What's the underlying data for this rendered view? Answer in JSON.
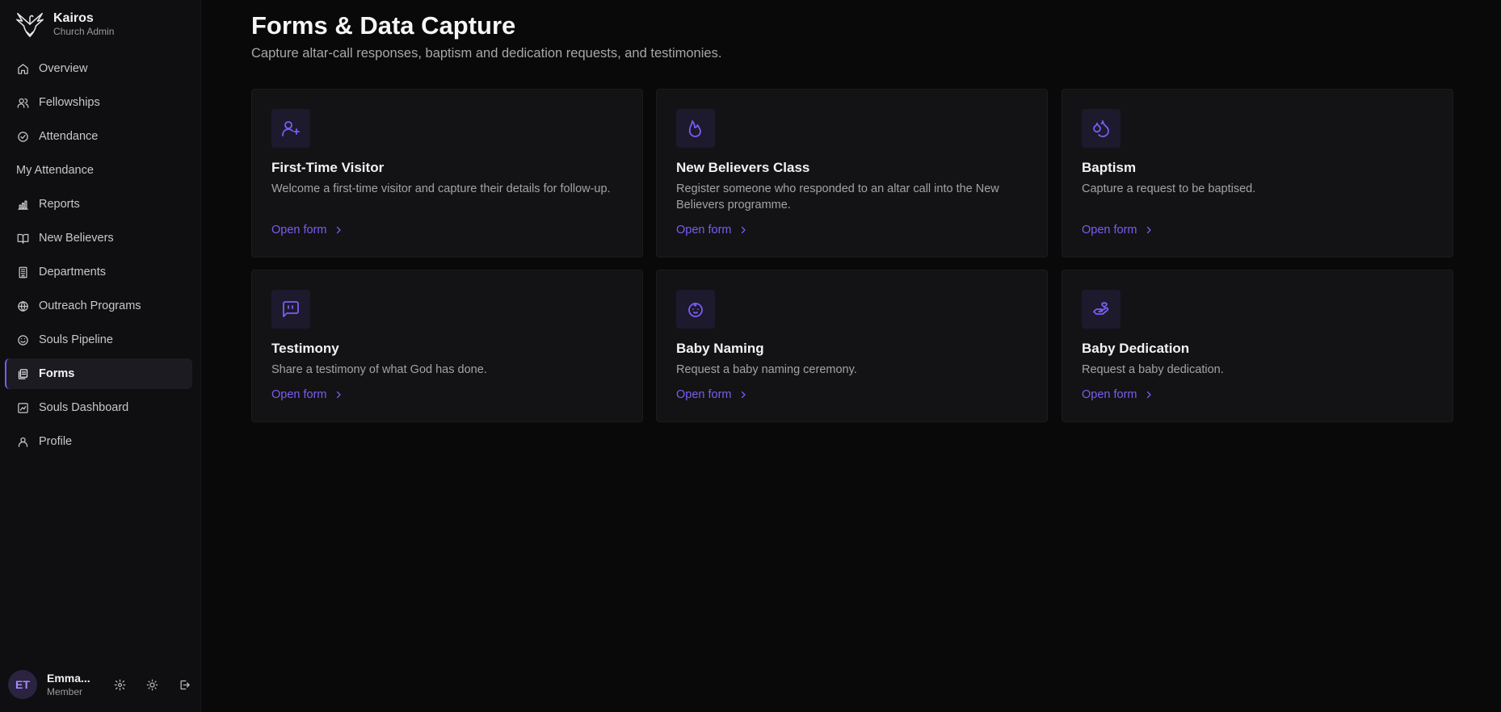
{
  "brand": {
    "name": "Kairos",
    "subtitle": "Church Admin"
  },
  "nav": [
    {
      "label": "Overview",
      "icon": "home-icon"
    },
    {
      "label": "Fellowships",
      "icon": "users-icon"
    },
    {
      "label": "Attendance",
      "icon": "check-circle-icon"
    },
    {
      "label": "My Attendance",
      "icon": ""
    },
    {
      "label": "Reports",
      "icon": "bar-chart-icon"
    },
    {
      "label": "New Believers",
      "icon": "book-open-icon"
    },
    {
      "label": "Departments",
      "icon": "building-icon"
    },
    {
      "label": "Outreach Programs",
      "icon": "globe-icon"
    },
    {
      "label": "Souls Pipeline",
      "icon": "smile-icon"
    },
    {
      "label": "Forms",
      "icon": "files-icon",
      "active": true
    },
    {
      "label": "Souls Dashboard",
      "icon": "dashboard-icon"
    },
    {
      "label": "Profile",
      "icon": "user-icon"
    }
  ],
  "user": {
    "initials": "ET",
    "name": "Emma...",
    "role": "Member"
  },
  "page": {
    "title": "Forms & Data Capture",
    "subtitle": "Capture altar-call responses, baptism and dedication requests, and testimonies."
  },
  "cards": [
    {
      "title": "First-Time Visitor",
      "description": "Welcome a first-time visitor and capture their details for follow-up.",
      "link": "Open form",
      "icon": "user-plus-icon"
    },
    {
      "title": "New Believers Class",
      "description": "Register someone who responded to an altar call into the New Believers programme.",
      "link": "Open form",
      "icon": "flame-icon"
    },
    {
      "title": "Baptism",
      "description": "Capture a request to be baptised.",
      "link": "Open form",
      "icon": "droplets-icon"
    },
    {
      "title": "Testimony",
      "description": "Share a testimony of what God has done.",
      "link": "Open form",
      "icon": "message-quote-icon"
    },
    {
      "title": "Baby Naming",
      "description": "Request a baby naming ceremony.",
      "link": "Open form",
      "icon": "baby-icon"
    },
    {
      "title": "Baby Dedication",
      "description": "Request a baby dedication.",
      "link": "Open form",
      "icon": "hand-heart-icon"
    }
  ],
  "colors": {
    "accent": "#7c5cf2",
    "background": "#09090a",
    "sidebar": "#0f0f11",
    "card": "#131315"
  }
}
